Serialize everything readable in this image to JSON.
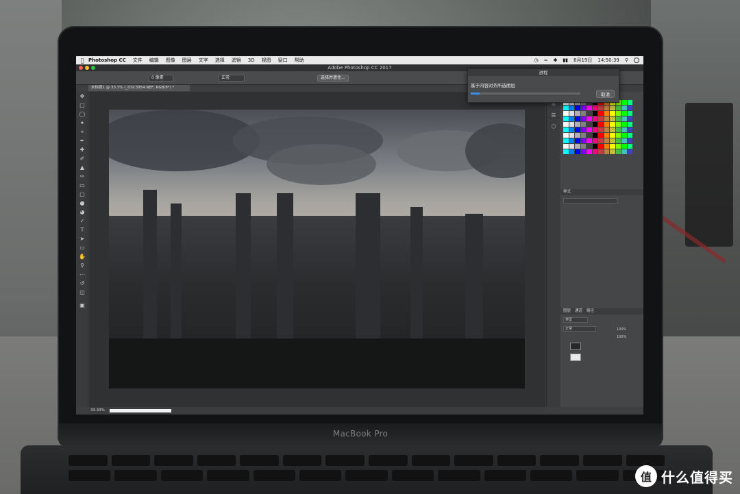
{
  "menubar": {
    "app_name": "Photoshop CC",
    "items": [
      "文件",
      "编辑",
      "图像",
      "图层",
      "文字",
      "选择",
      "滤镜",
      "3D",
      "视图",
      "窗口",
      "帮助"
    ],
    "date": "8月19日",
    "time": "14:50:39"
  },
  "window": {
    "title": "Adobe Photoshop CC 2017"
  },
  "options": {
    "feather_value": "0 像素",
    "style_select": "正常",
    "select_mask_button": "选择并遮住..."
  },
  "document": {
    "tab_label": "未标题1 @ 33.3% (_DSC3954.NEF, RGB/8*) *"
  },
  "panels": {
    "styles_tab": "样式",
    "layer_tabs": [
      "图层",
      "通道",
      "路径"
    ],
    "kind_filter": "类型",
    "blend_mode": "正常",
    "opacity": "100%",
    "fill": "100%"
  },
  "status": {
    "zoom": "33.33%"
  },
  "progress_dialog": {
    "title": "进程",
    "message": "基于内容对齐所选图层",
    "progress": 0.08,
    "cancel_label": "取消"
  },
  "laptop": {
    "brand": "MacBook Pro"
  },
  "watermark": {
    "logo": "值",
    "text": "什么值得买"
  },
  "colors": {
    "accent": "#3a8ee6"
  }
}
